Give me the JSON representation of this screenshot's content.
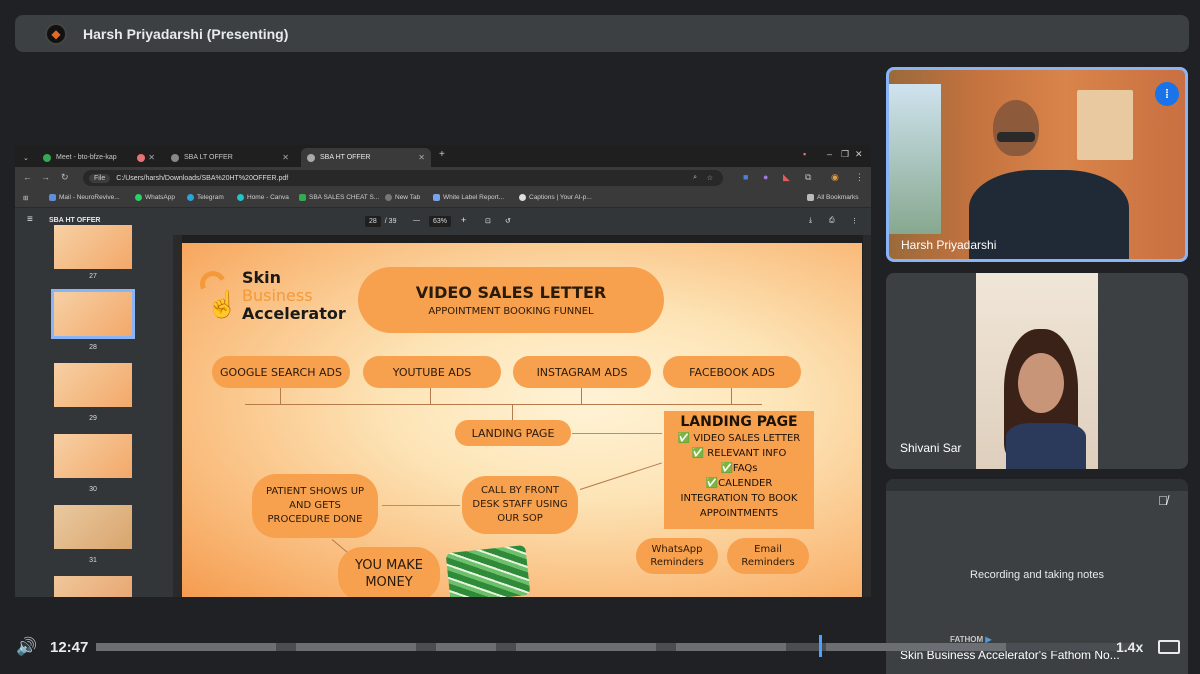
{
  "top_bar": {
    "presenter_title": "Harsh Priyadarshi (Presenting)"
  },
  "browser": {
    "tabs": [
      {
        "label": "Meet - bto-bfze-kap",
        "active": false
      },
      {
        "label": "SBA LT OFFER",
        "active": false
      },
      {
        "label": "SBA HT OFFER",
        "active": true
      }
    ],
    "new_tab": "+",
    "url_chip": "File",
    "url": "C:/Users/harsh/Downloads/SBA%20HT%20OFFER.pdf",
    "bookmarks": [
      "Mail - NeuroRevive...",
      "WhatsApp",
      "Telegram",
      "Home - Canva",
      "SBA SALES CHEAT S...",
      "New Tab",
      "White Label Report...",
      "Captions | Your AI-p..."
    ],
    "all_bookmarks": "All Bookmarks"
  },
  "pdf_viewer": {
    "doc_title": "SBA HT OFFER",
    "page_current": "28",
    "page_total": "/ 39",
    "zoom": "63%",
    "thumbnails": [
      "27",
      "28",
      "29",
      "30",
      "31"
    ]
  },
  "slide": {
    "logo": {
      "line1": "Skin",
      "line2": "Business",
      "line3": "Accelerator"
    },
    "title": "VIDEO SALES LETTER",
    "subtitle": "APPOINTMENT BOOKING FUNNEL",
    "sources": [
      "GOOGLE SEARCH ADS",
      "YOUTUBE ADS",
      "INSTAGRAM ADS",
      "FACEBOOK ADS"
    ],
    "landing_page": "LANDING PAGE",
    "landing_box_title": "LANDING PAGE",
    "landing_box_items": [
      "VIDEO SALES LETTER",
      "RELEVANT INFO",
      "FAQs",
      "CALENDER"
    ],
    "landing_box_footer": "INTEGRATION TO BOOK APPOINTMENTS",
    "reminders": [
      "WhatsApp Reminders",
      "Email Reminders"
    ],
    "call_step": "CALL BY FRONT DESK STAFF USING OUR SOP",
    "patient_step": "PATIENT SHOWS UP AND GETS PROCEDURE DONE",
    "money_step": "YOU MAKE MONEY"
  },
  "participants": [
    {
      "name": "Harsh Priyadarshi",
      "speaking": true
    },
    {
      "name": "Shivani Sar"
    },
    {
      "status": "Recording and taking notes",
      "muted": true
    }
  ],
  "notetaker": {
    "brand": "FATHOM",
    "caption": "Skin Business Accelerator's Fathom No..."
  },
  "player": {
    "time": "12:47",
    "speed": "1.4x"
  },
  "colors": {
    "accent": "#8ab4f8",
    "slide_orange": "#f7a04e",
    "bg": "#202124"
  }
}
